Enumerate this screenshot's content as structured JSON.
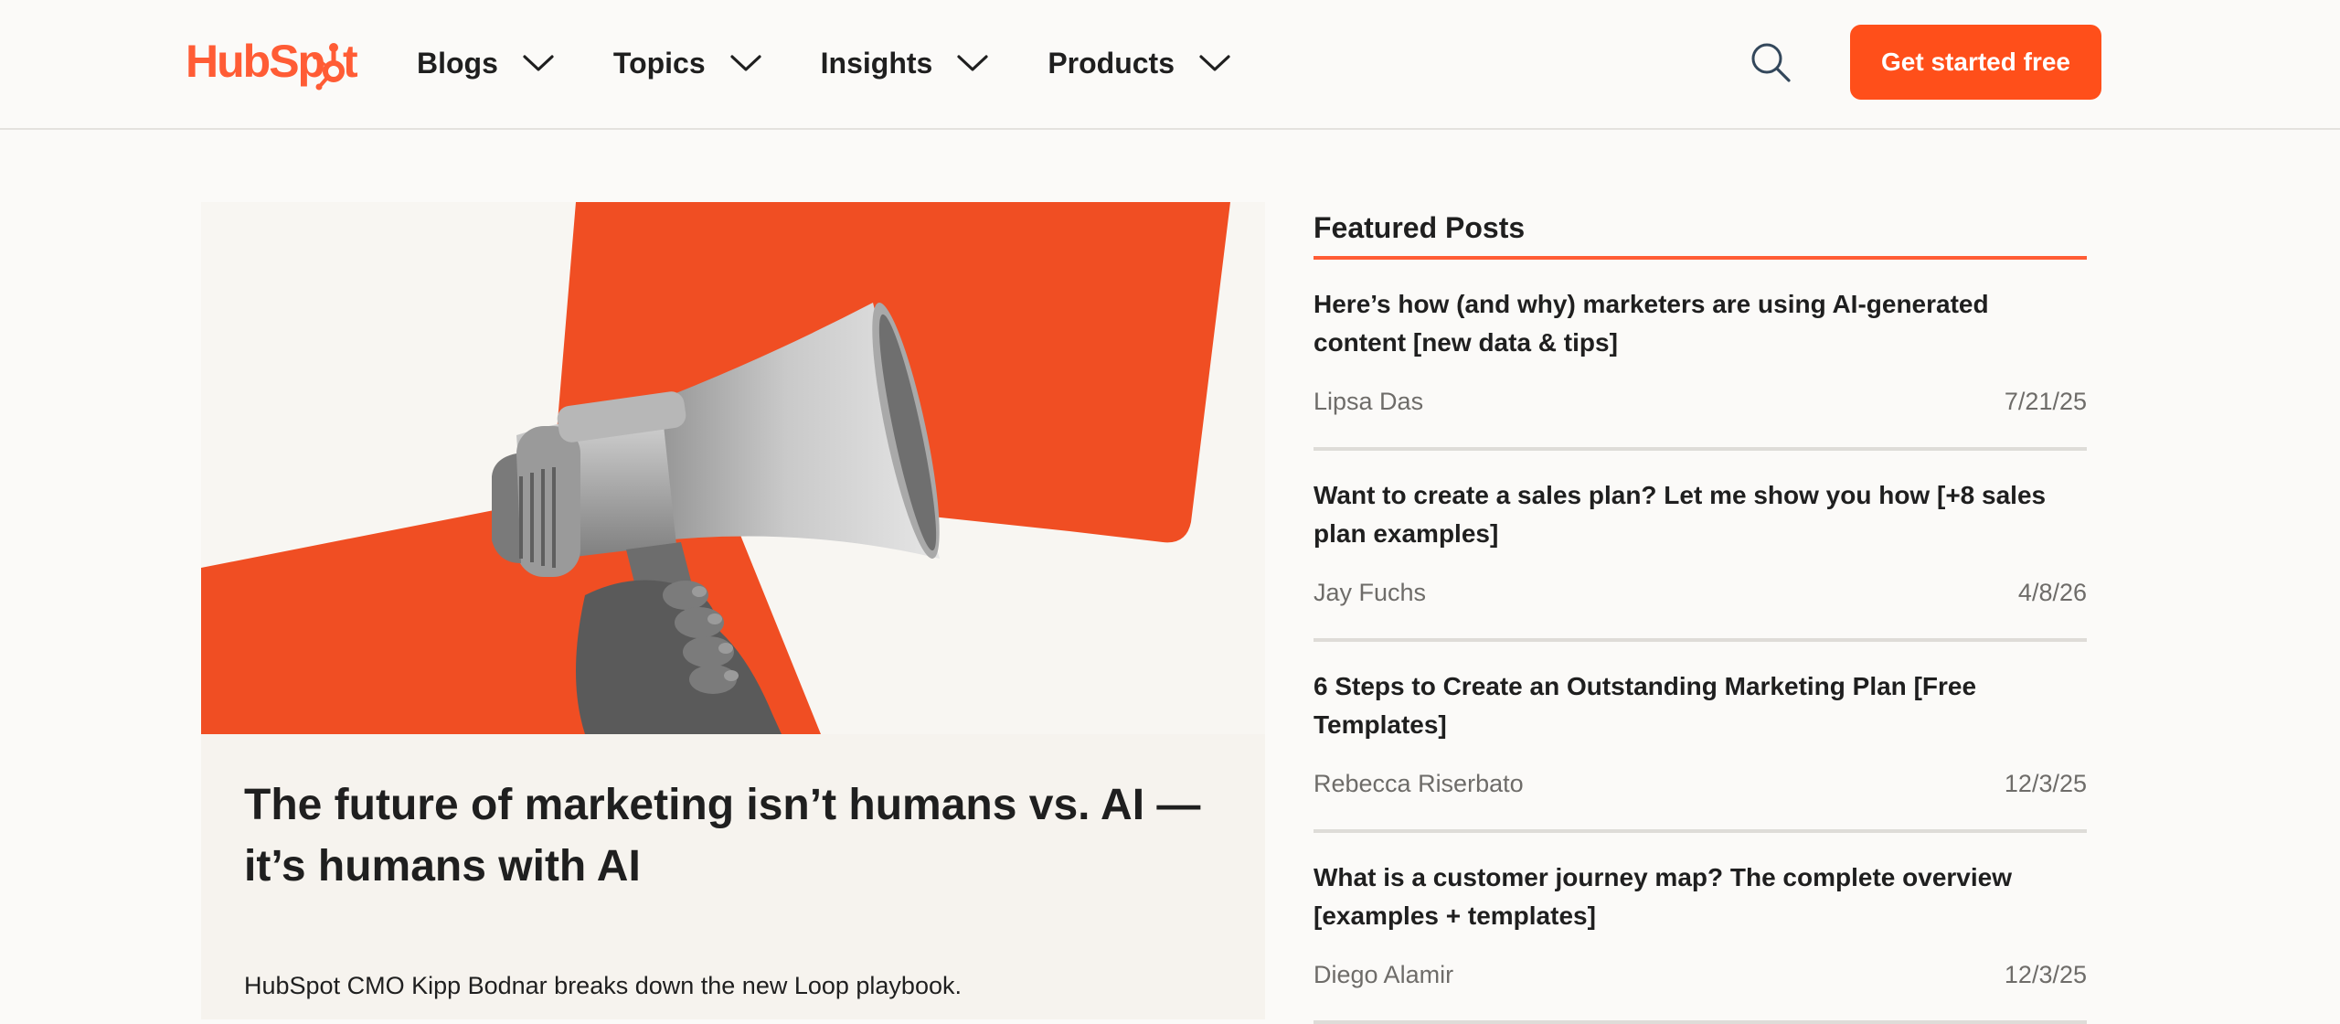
{
  "header": {
    "logo_text": "HubSpot",
    "logo_color": "#ff5c35",
    "nav": [
      {
        "label": "Blogs",
        "icon": "chevron-down-icon"
      },
      {
        "label": "Topics",
        "icon": "chevron-down-icon"
      },
      {
        "label": "Insights",
        "icon": "chevron-down-icon"
      },
      {
        "label": "Products",
        "icon": "chevron-down-icon"
      }
    ],
    "search_icon": "search-icon",
    "cta_label": "Get started free",
    "cta_color": "#ff4f1a"
  },
  "hero": {
    "image": "megaphone-illustration",
    "accent_color": "#f04e23",
    "title": "The future of marketing isn’t humans vs. AI — it’s humans with AI",
    "description": "HubSpot CMO Kipp Bodnar breaks down the new Loop playbook."
  },
  "featured": {
    "heading": "Featured Posts",
    "posts": [
      {
        "title": "Here’s how (and why) marketers are using AI-generated content [new data & tips]",
        "author": "Lipsa Das",
        "date": "7/21/25"
      },
      {
        "title": "Want to create a sales plan? Let me show you how [+8 sales plan examples]",
        "author": "Jay Fuchs",
        "date": "4/8/26"
      },
      {
        "title": "6 Steps to Create an Outstanding Marketing Plan [Free Templates]",
        "author": "Rebecca Riserbato",
        "date": "12/3/25"
      },
      {
        "title": "What is a customer journey map? The complete overview [examples + templates]",
        "author": "Diego Alamir",
        "date": "12/3/25"
      }
    ]
  }
}
